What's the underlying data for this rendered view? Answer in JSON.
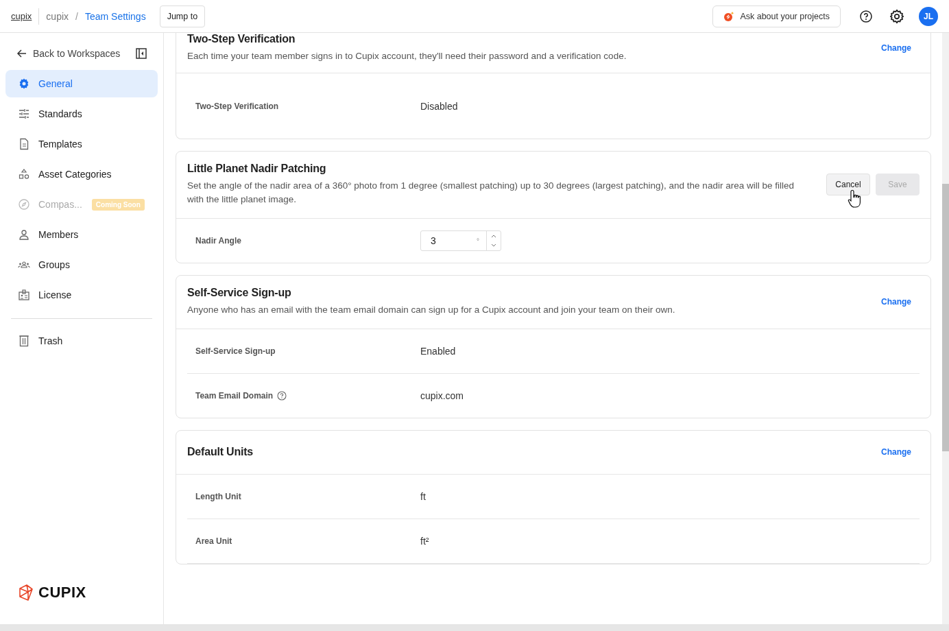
{
  "header": {
    "home_link": "cupix",
    "breadcrumb": [
      "cupix",
      "Team Settings"
    ],
    "breadcrumb_separator": "/",
    "jump_button": "Jump to",
    "ask_button": "Ask about your projects",
    "avatar": "JL"
  },
  "sidebar": {
    "back_link": "Back to Workspaces",
    "items": [
      {
        "label": "General",
        "selected": true,
        "disabled": false
      },
      {
        "label": "Standards",
        "selected": false,
        "disabled": false
      },
      {
        "label": "Templates",
        "selected": false,
        "disabled": false
      },
      {
        "label": "Asset Categories",
        "selected": false,
        "disabled": false
      },
      {
        "label": "Compas...",
        "selected": false,
        "disabled": true,
        "badge": "Coming Soon"
      },
      {
        "label": "Members",
        "selected": false,
        "disabled": false
      },
      {
        "label": "Groups",
        "selected": false,
        "disabled": false
      },
      {
        "label": "License",
        "selected": false,
        "disabled": false
      }
    ],
    "footer_items": [
      {
        "label": "Trash",
        "selected": false,
        "disabled": false
      }
    ],
    "logo": "CUPIX"
  },
  "sections": [
    {
      "title": "Two-Step Verification",
      "description": "Each time your team member signs in to Cupix account, they'll need their password and a verification code.",
      "action": {
        "kind": "link",
        "label": "Change"
      },
      "rows": [
        {
          "kind": "text",
          "label": "Two-Step Verification",
          "value": "Disabled",
          "help": false
        }
      ]
    },
    {
      "title": "Little Planet Nadir Patching",
      "description": "Set the angle of the nadir area of a 360° photo from 1 degree (smallest patching) up to 30 degrees (largest patching), and the nadir area will be filled with the little planet image.",
      "action": {
        "kind": "buttons",
        "buttons": [
          {
            "label": "Cancel",
            "disabled": false
          },
          {
            "label": "Save",
            "disabled": true
          }
        ]
      },
      "rows": [
        {
          "kind": "number",
          "label": "Nadir Angle",
          "value": "3",
          "unit": "°",
          "help": false
        }
      ]
    },
    {
      "title": "Self-Service Sign-up",
      "description": "Anyone who has an email with the team email domain can sign up for a Cupix account and join your team on their own.",
      "action": {
        "kind": "link",
        "label": "Change"
      },
      "rows": [
        {
          "kind": "text",
          "label": "Self-Service Sign-up",
          "value": "Enabled",
          "help": false
        },
        {
          "kind": "text",
          "label": "Team Email Domain",
          "value": "cupix.com",
          "help": true
        }
      ]
    },
    {
      "title": "Default Units",
      "action": {
        "kind": "link",
        "label": "Change"
      },
      "rows": [
        {
          "kind": "text",
          "label": "Length Unit",
          "value": "ft",
          "help": false
        },
        {
          "kind": "text",
          "label": "Area Unit",
          "value": "ft²",
          "help": false
        }
      ]
    }
  ]
}
